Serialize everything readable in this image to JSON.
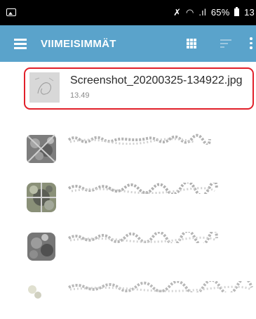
{
  "status_bar": {
    "battery_percent": "65%",
    "clock_partial": "13"
  },
  "app_bar": {
    "title": "VIIMEISIMMÄT",
    "icons": [
      "menu-icon",
      "grid-view-icon",
      "sort-icon",
      "more-icon"
    ]
  },
  "files": [
    {
      "name": "Screenshot_20200325-134922.jpg",
      "time": "13.49",
      "highlighted": true
    }
  ],
  "colors": {
    "app_bar": "#5aa3cb",
    "status_bar": "#000000",
    "highlight": "#e1202a"
  }
}
